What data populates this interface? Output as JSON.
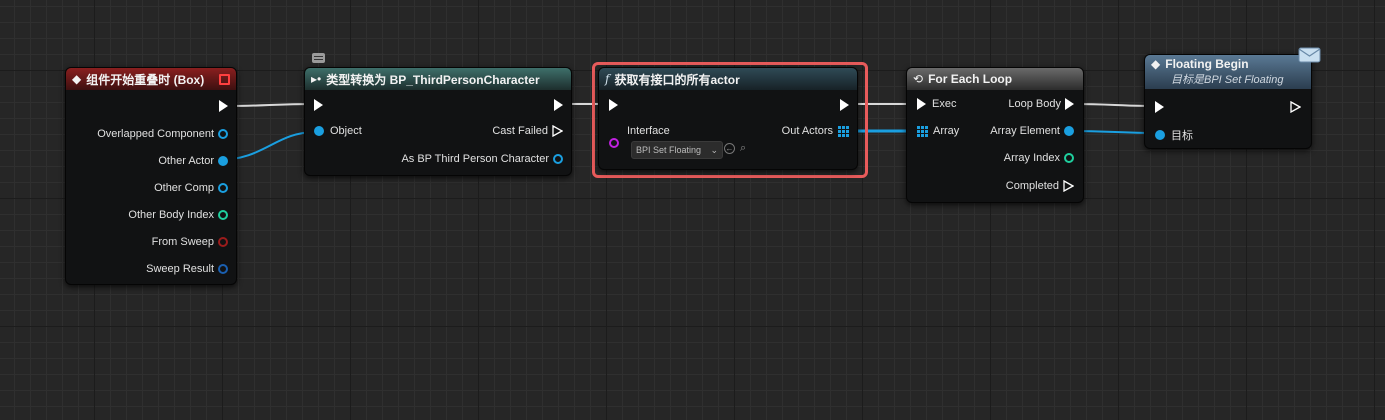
{
  "colors": {
    "background": "#262626",
    "exec_pin": "#ffffff",
    "object_pin": "#1a9fe0",
    "integer_pin": "#1fcf9e",
    "bool_pin": "#9b1c1c",
    "struct_pin": "#1a5fb0",
    "interface_pin": "#c020e0",
    "highlight": "#e85b5b"
  },
  "nodes": {
    "begin_overlap": {
      "title": "组件开始重叠时 (Box)",
      "pins": {
        "overlapped_component": "Overlapped Component",
        "other_actor": "Other Actor",
        "other_comp": "Other Comp",
        "other_body_index": "Other Body Index",
        "from_sweep": "From Sweep",
        "sweep_result": "Sweep Result"
      }
    },
    "cast": {
      "title": "类型转换为 BP_ThirdPersonCharacter",
      "pins": {
        "object": "Object",
        "cast_failed": "Cast Failed",
        "as_bp": "As BP Third Person Character"
      }
    },
    "get_all": {
      "title": "获取有接口的所有actor",
      "pins": {
        "interface": "Interface",
        "interface_value": "BPI Set Floating",
        "out_actors": "Out Actors"
      }
    },
    "for_each": {
      "title": "For Each Loop",
      "pins": {
        "exec": "Exec",
        "array": "Array",
        "loop_body": "Loop Body",
        "array_element": "Array Element",
        "array_index": "Array Index",
        "completed": "Completed"
      }
    },
    "floating_begin": {
      "title": "Floating Begin",
      "subtitle": "目标是BPI Set Floating",
      "pins": {
        "target": "目标"
      }
    }
  }
}
